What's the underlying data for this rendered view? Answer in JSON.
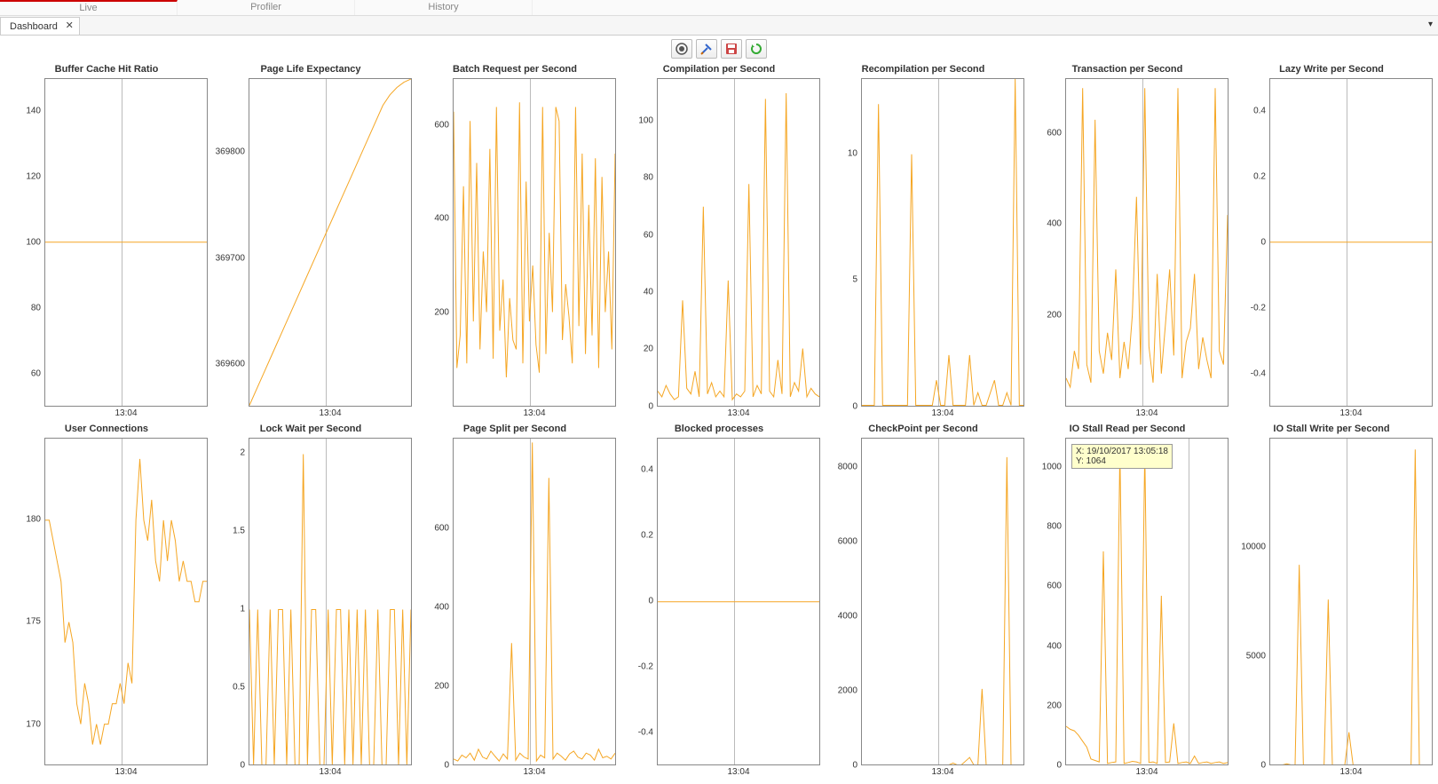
{
  "colors": {
    "line": "#f5a623",
    "axis": "#888",
    "cursor": "#c8c8c8"
  },
  "top_nav": {
    "tabs": [
      "Live",
      "Profiler",
      "History"
    ],
    "active": 0
  },
  "doc_tabs": {
    "active": "Dashboard"
  },
  "toolbar": {
    "buttons": [
      {
        "name": "record-icon",
        "title": "Record"
      },
      {
        "name": "tools-icon",
        "title": "Tools"
      },
      {
        "name": "save-icon",
        "title": "Save"
      },
      {
        "name": "refresh-icon",
        "title": "Refresh"
      }
    ]
  },
  "xlabel": "13:04",
  "cursors": {
    "default_pct": 47,
    "io_stall_read_pct": 76
  },
  "tooltip": {
    "line1": "X: 19/10/2017 13:05:18",
    "line2": "Y: 1064"
  },
  "chart_data": [
    {
      "id": "buffer_cache",
      "title": "Buffer Cache Hit Ratio",
      "type": "line",
      "yticks": [
        60,
        80,
        100,
        120,
        140
      ],
      "ylim": [
        50,
        150
      ],
      "values": [
        100,
        100,
        100,
        100,
        100,
        100,
        100,
        100,
        100,
        100,
        100,
        100,
        100,
        100,
        100,
        100,
        100,
        100,
        100,
        100,
        100,
        100,
        100,
        100
      ]
    },
    {
      "id": "page_life",
      "title": "Page Life Expectancy",
      "type": "line",
      "yticks": [
        369600,
        369700,
        369800
      ],
      "ylim": [
        369560,
        369870
      ],
      "values": [
        369560,
        369575,
        369590,
        369605,
        369620,
        369635,
        369650,
        369665,
        369680,
        369695,
        369710,
        369725,
        369740,
        369755,
        369770,
        369785,
        369800,
        369815,
        369830,
        369845,
        369855,
        369862,
        369867,
        369870
      ]
    },
    {
      "id": "batch_req",
      "title": "Batch Request per Second",
      "type": "line",
      "yticks": [
        200,
        400,
        600
      ],
      "ylim": [
        0,
        700
      ],
      "values": [
        630,
        80,
        150,
        470,
        90,
        610,
        180,
        520,
        120,
        330,
        200,
        550,
        100,
        640,
        160,
        270,
        60,
        230,
        140,
        120,
        650,
        90,
        480,
        180,
        300,
        130,
        70,
        640,
        110,
        370,
        200,
        640,
        610,
        140,
        260,
        190,
        90,
        640,
        170,
        540,
        110,
        430,
        150,
        530,
        80,
        490,
        200,
        330,
        120,
        540
      ]
    },
    {
      "id": "compilation",
      "title": "Compilation per Second",
      "type": "line",
      "yticks": [
        0,
        20,
        40,
        60,
        80,
        100
      ],
      "ylim": [
        0,
        115
      ],
      "values": [
        5,
        3,
        7,
        4,
        2,
        3,
        37,
        6,
        4,
        12,
        3,
        70,
        4,
        8,
        3,
        5,
        3,
        44,
        2,
        4,
        3,
        5,
        78,
        3,
        7,
        4,
        108,
        5,
        3,
        16,
        4,
        110,
        3,
        8,
        5,
        20,
        3,
        6,
        4,
        3
      ]
    },
    {
      "id": "recompilation",
      "title": "Recompilation per Second",
      "type": "line",
      "yticks": [
        0,
        5,
        10
      ],
      "ylim": [
        0,
        13
      ],
      "values": [
        0,
        0,
        0,
        0,
        12,
        0,
        0,
        0,
        0,
        0,
        0,
        0,
        10,
        0,
        0,
        0,
        0,
        0,
        1,
        0,
        0,
        2,
        0,
        0,
        0,
        0,
        2,
        0,
        0.5,
        0,
        0,
        0.5,
        1,
        0,
        0,
        0.5,
        0,
        13,
        0,
        0
      ]
    },
    {
      "id": "transaction",
      "title": "Transaction per Second",
      "type": "line",
      "yticks": [
        200,
        400,
        600
      ],
      "ylim": [
        0,
        720
      ],
      "values": [
        60,
        40,
        120,
        80,
        700,
        90,
        50,
        630,
        120,
        70,
        160,
        100,
        300,
        60,
        140,
        80,
        200,
        460,
        90,
        700,
        130,
        50,
        290,
        70,
        180,
        300,
        110,
        700,
        60,
        140,
        170,
        290,
        80,
        150,
        100,
        60,
        700,
        120,
        90,
        420
      ]
    },
    {
      "id": "lazy_write",
      "title": "Lazy Write per Second",
      "type": "line",
      "yticks": [
        -0.4,
        -0.2,
        0,
        0.2,
        0.4
      ],
      "ylim": [
        -0.5,
        0.5
      ],
      "values": [
        0,
        0,
        0,
        0,
        0,
        0,
        0,
        0,
        0,
        0,
        0,
        0,
        0,
        0,
        0,
        0,
        0,
        0,
        0,
        0,
        0,
        0,
        0,
        0
      ]
    },
    {
      "id": "user_conn",
      "title": "User Connections",
      "type": "line",
      "yticks": [
        170,
        175,
        180
      ],
      "ylim": [
        168,
        184
      ],
      "values": [
        180,
        180,
        179,
        178,
        177,
        174,
        175,
        174,
        171,
        170,
        172,
        171,
        169,
        170,
        169,
        170,
        170,
        171,
        171,
        172,
        171,
        173,
        172,
        180,
        183,
        180,
        179,
        181,
        178,
        177,
        180,
        178,
        180,
        179,
        177,
        178,
        177,
        177,
        176,
        176,
        177,
        177
      ]
    },
    {
      "id": "lock_wait",
      "title": "Lock Wait per Second",
      "type": "line",
      "yticks": [
        0,
        0.5,
        1,
        1.5,
        2
      ],
      "ylim": [
        0,
        2.1
      ],
      "values": [
        1,
        0,
        1,
        0,
        0,
        1,
        0,
        1,
        1,
        0,
        1,
        0,
        0,
        2,
        0,
        1,
        1,
        0,
        0,
        1,
        0,
        1,
        1,
        0,
        1,
        0,
        1,
        0,
        1,
        0,
        0,
        1,
        0,
        0,
        1,
        1,
        0,
        1,
        0,
        1
      ]
    },
    {
      "id": "page_split",
      "title": "Page Split per Second",
      "type": "line",
      "yticks": [
        0,
        200,
        400,
        600
      ],
      "ylim": [
        0,
        830
      ],
      "values": [
        15,
        10,
        25,
        18,
        30,
        12,
        40,
        20,
        15,
        35,
        22,
        10,
        28,
        15,
        310,
        12,
        30,
        20,
        15,
        820,
        10,
        25,
        18,
        730,
        15,
        30,
        22,
        12,
        28,
        35,
        20,
        15,
        30,
        25,
        12,
        40,
        18,
        22,
        15,
        30
      ]
    },
    {
      "id": "blocked",
      "title": "Blocked processes",
      "type": "line",
      "yticks": [
        -0.4,
        -0.2,
        0,
        0.2,
        0.4
      ],
      "ylim": [
        -0.5,
        0.5
      ],
      "values": [
        0,
        0,
        0,
        0,
        0,
        0,
        0,
        0,
        0,
        0,
        0,
        0,
        0,
        0,
        0,
        0,
        0,
        0,
        0,
        0,
        0,
        0,
        0,
        0
      ]
    },
    {
      "id": "checkpoint",
      "title": "CheckPoint per Second",
      "type": "line",
      "yticks": [
        0,
        2000,
        4000,
        6000,
        8000
      ],
      "ylim": [
        0,
        8800
      ],
      "values": [
        0,
        0,
        0,
        0,
        0,
        0,
        0,
        0,
        0,
        0,
        0,
        0,
        0,
        0,
        0,
        0,
        0,
        0,
        0,
        0,
        0,
        0,
        50,
        0,
        0,
        100,
        200,
        0,
        0,
        2050,
        0,
        0,
        0,
        0,
        0,
        8300,
        0,
        0,
        0,
        0
      ]
    },
    {
      "id": "io_stall_read",
      "title": "IO Stall Read per Second",
      "type": "line",
      "yticks": [
        0,
        200,
        400,
        600,
        800,
        1000
      ],
      "ylim": [
        0,
        1100
      ],
      "values": [
        130,
        120,
        115,
        100,
        80,
        60,
        20,
        15,
        10,
        720,
        5,
        8,
        10,
        1064,
        5,
        8,
        12,
        10,
        5,
        1060,
        8,
        10,
        5,
        570,
        8,
        10,
        140,
        5,
        8,
        10,
        5,
        30,
        5,
        8,
        10,
        5,
        8,
        10,
        5,
        8
      ],
      "cursor_pct": 76
    },
    {
      "id": "io_stall_write",
      "title": "IO Stall Write per Second",
      "type": "line",
      "yticks": [
        0,
        5000,
        10000
      ],
      "ylim": [
        0,
        15000
      ],
      "values": [
        0,
        0,
        0,
        0,
        50,
        0,
        0,
        9200,
        0,
        0,
        0,
        0,
        0,
        0,
        7600,
        0,
        0,
        0,
        0,
        1500,
        0,
        0,
        0,
        0,
        0,
        0,
        0,
        0,
        0,
        0,
        0,
        0,
        0,
        0,
        0,
        14500,
        0,
        0,
        0,
        0
      ]
    }
  ]
}
